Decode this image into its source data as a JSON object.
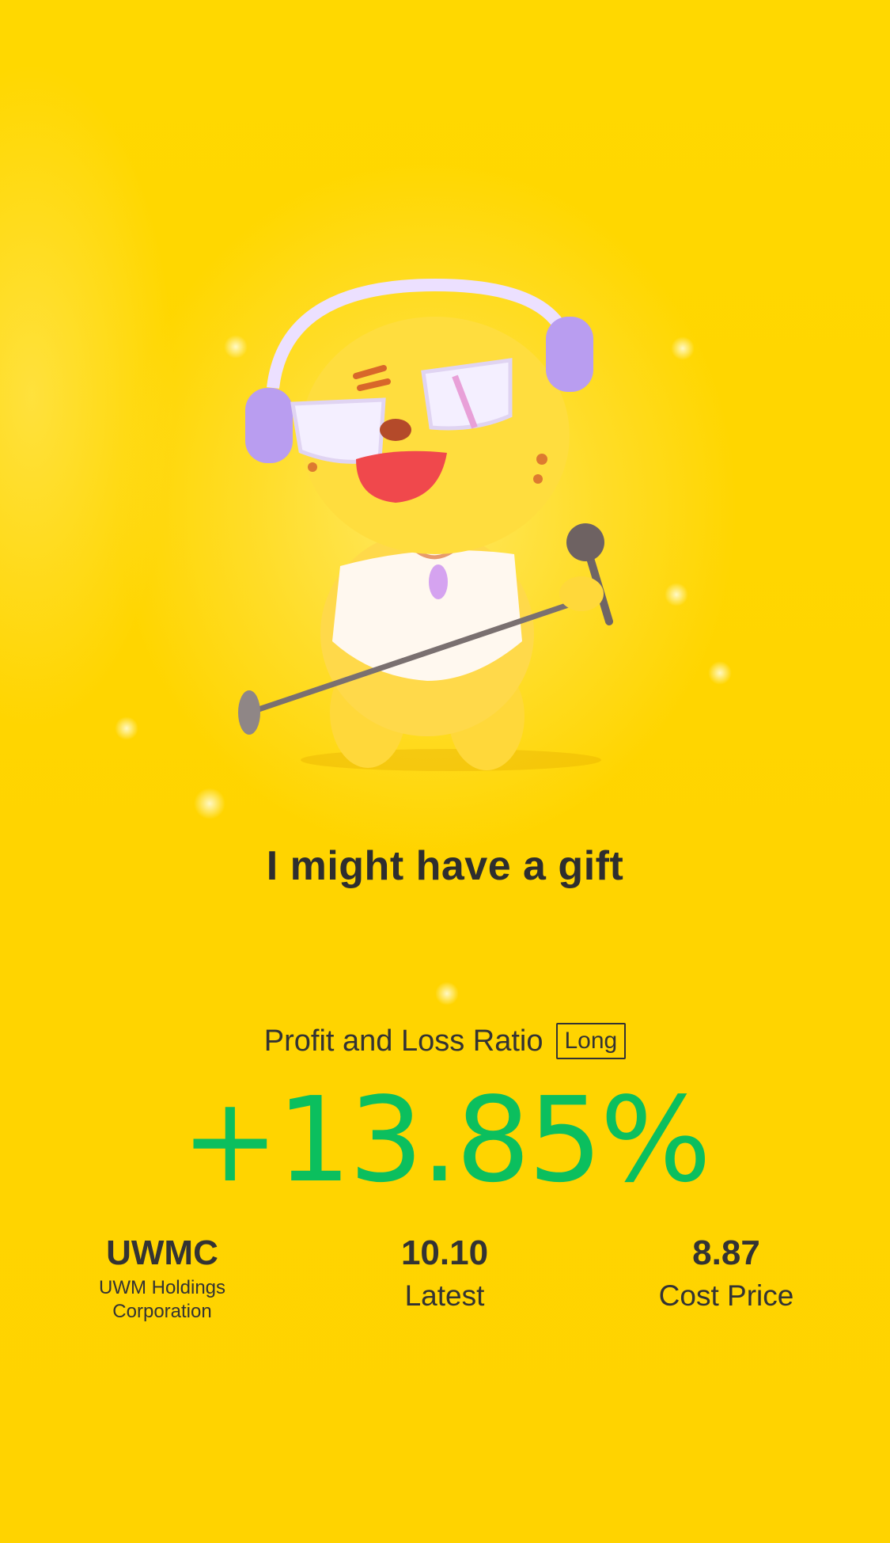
{
  "headline": "I might have a gift",
  "ratio": {
    "label": "Profit and Loss Ratio",
    "tag": "Long",
    "value": "+13.85%",
    "color": "#0bbf5e"
  },
  "stock": {
    "ticker": "UWMC",
    "name": "UWM Holdings Corporation"
  },
  "latest": {
    "value": "10.10",
    "label": "Latest"
  },
  "cost": {
    "value": "8.87",
    "label": "Cost Price"
  },
  "mascot": {
    "icon": "tiger-mascot-with-headphones-and-microphone-icon"
  },
  "colors": {
    "background": "#ffd800",
    "text": "#333333",
    "accent": "#0bbf5e"
  }
}
